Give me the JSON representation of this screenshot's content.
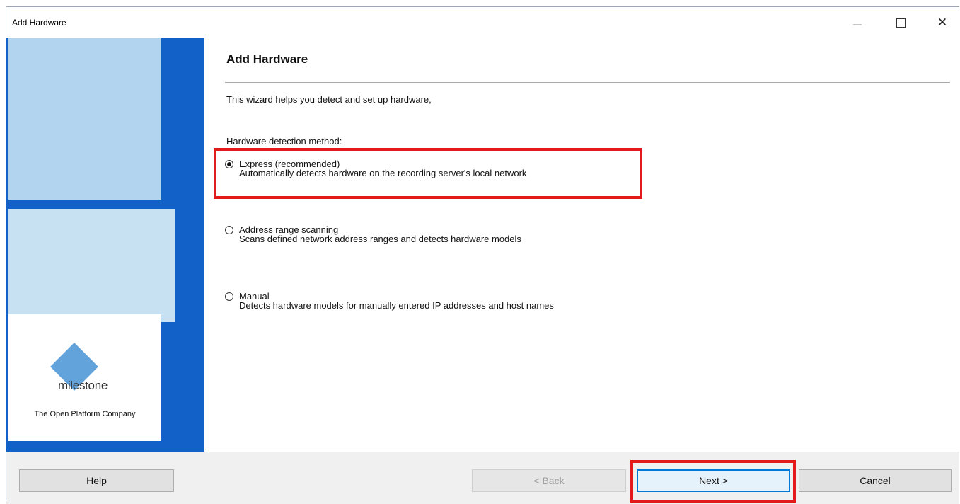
{
  "window": {
    "title": "Add Hardware"
  },
  "banner": {
    "logo_text": "milestone",
    "tagline": "The Open Platform Company"
  },
  "content": {
    "heading": "Add Hardware",
    "intro": "This wizard helps you detect and set up hardware,",
    "method_label": "Hardware detection method:",
    "options": [
      {
        "title": "Express (recommended)",
        "description": "Automatically detects hardware on the recording server's local network",
        "selected": true
      },
      {
        "title": "Address range scanning",
        "description": "Scans defined network address ranges and detects hardware models",
        "selected": false
      },
      {
        "title": "Manual",
        "description": "Detects hardware models for manually entered IP addresses and host names",
        "selected": false
      }
    ]
  },
  "buttons": {
    "help": "Help",
    "back": "< Back",
    "next": "Next >",
    "cancel": "Cancel"
  },
  "colors": {
    "highlight": "#e31a1c",
    "banner_blue": "#1261c9",
    "banner_light": "#b3d4ee",
    "logo_diamond": "#63a3dc"
  }
}
